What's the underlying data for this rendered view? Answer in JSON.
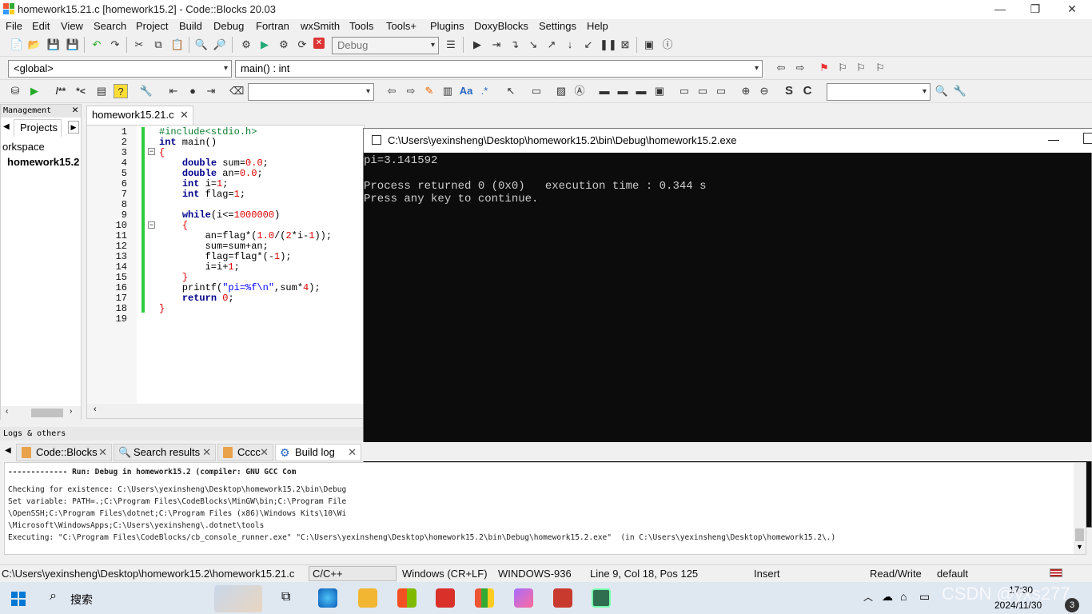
{
  "window": {
    "title": "homework15.21.c [homework15.2] - Code::Blocks 20.03",
    "minimize": "—",
    "maximize": "❐",
    "close": "✕"
  },
  "menu": [
    "File",
    "Edit",
    "View",
    "Search",
    "Project",
    "Build",
    "Debug",
    "Fortran",
    "wxSmith",
    "Tools",
    "Tools+",
    "Plugins",
    "DoxyBlocks",
    "Settings",
    "Help"
  ],
  "toolbar": {
    "build_target": "Debug",
    "scope": "<global>",
    "function": "main() : int"
  },
  "management": {
    "title": "Management",
    "tab_projects": "Projects",
    "workspace": "orkspace",
    "project": "homework15.2"
  },
  "editor": {
    "tab": "homework15.21.c",
    "line_numbers": [
      "1",
      "2",
      "3",
      "4",
      "5",
      "6",
      "7",
      "8",
      "9",
      "10",
      "11",
      "12",
      "13",
      "14",
      "15",
      "16",
      "17",
      "18",
      "19"
    ]
  },
  "console": {
    "title": "C:\\Users\\yexinsheng\\Desktop\\homework15.2\\bin\\Debug\\homework15.2.exe",
    "lines": [
      "pi=3.141592",
      "",
      "Process returned 0 (0x0)   execution time : 0.344 s",
      "Press any key to continue."
    ]
  },
  "logs": {
    "header": "Logs & others",
    "tabs": [
      "Code::Blocks",
      "Search results",
      "Cccc",
      "Build log"
    ],
    "lines": [
      "------------- Run: Debug in homework15.2 (compiler: GNU GCC Com",
      "Checking for existence: C:\\Users\\yexinsheng\\Desktop\\homework15.2\\bin\\Debug",
      "Set variable: PATH=.;C:\\Program Files\\CodeBlocks\\MinGW\\bin;C:\\Program File",
      "\\OpenSSH;C:\\Program Files\\dotnet;C:\\Program Files (x86)\\Windows Kits\\10\\Wi",
      "\\Microsoft\\WindowsApps;C:\\Users\\yexinsheng\\.dotnet\\tools",
      "Executing: \"C:\\Program Files\\CodeBlocks/cb_console_runner.exe\" \"C:\\Users\\yexinsheng\\Desktop\\homework15.2\\bin\\Debug\\homework15.2.exe\"  (in C:\\Users\\yexinsheng\\Desktop\\homework15.2\\.)"
    ]
  },
  "status": {
    "path": "C:\\Users\\yexinsheng\\Desktop\\homework15.2\\homework15.21.c",
    "lang": "C/C++",
    "eol": "Windows (CR+LF)",
    "encoding": "WINDOWS-936",
    "position": "Line 9, Col 18, Pos 125",
    "mode": "Insert",
    "access": "Read/Write",
    "profile": "default"
  },
  "taskbar": {
    "search": "搜索",
    "time": "17:30",
    "date": "2024/11/30",
    "badge": "3",
    "watermark": "CSDN @yxs277"
  }
}
